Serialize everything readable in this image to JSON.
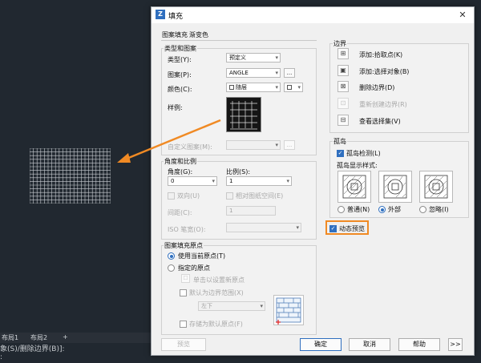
{
  "background": {
    "layout_tabs": [
      "布局1",
      "布局2",
      "+"
    ],
    "command_line": "象(S)/删除边界(B)]:",
    "command_line2": ":"
  },
  "dialog": {
    "title": "填充",
    "close_glyph": "✕",
    "tabs": [
      "图案填充",
      "渐变色"
    ],
    "type_group": {
      "label": "类型和图案",
      "type_label": "类型(Y):",
      "type_value": "预定义",
      "pattern_label": "图案(P):",
      "pattern_value": "ANGLE",
      "pattern_browse": "...",
      "color_label": "颜色(C):",
      "color_value": "随层",
      "sample_label": "样例:",
      "custom_label": "自定义图案(M):",
      "custom_browse": "..."
    },
    "angle_group": {
      "label": "角度和比例",
      "angle_label": "角度(G):",
      "angle_value": "0",
      "scale_label": "比例(S):",
      "scale_value": "1",
      "double_label": "双向(U)",
      "relative_label": "相对图纸空间(E)",
      "spacing_label": "间距(C):",
      "spacing_value": "1",
      "iso_label": "ISO 笔宽(O):"
    },
    "origin_group": {
      "label": "图案填充原点",
      "use_current": "使用当前原点(T)",
      "specified": "指定的原点",
      "click_set": "单击以设置新原点",
      "default_extent": "默认为边界范围(X)",
      "position_value": "左下",
      "store_default": "存储为默认原点(F)"
    },
    "boundary_group": {
      "label": "边界",
      "add_pick": "添加:拾取点(K)",
      "add_select": "添加:选择对象(B)",
      "remove": "删除边界(D)",
      "recreate": "重新创建边界(R)",
      "view_selection": "查看选择集(V)"
    },
    "island_group": {
      "label": "孤岛",
      "detect": "孤岛检测(L)",
      "style_label": "孤岛显示样式:",
      "normal": "普通(N)",
      "outer": "外部",
      "ignore": "忽略(I)"
    },
    "dynamic_preview": "动态预览",
    "buttons": {
      "preview": "预览",
      "ok": "确定",
      "cancel": "取消",
      "help": "帮助",
      "more": ">>"
    }
  },
  "colors": {
    "accent": "#2f6fbf",
    "highlight": "#f08a24",
    "background": "#212830"
  }
}
